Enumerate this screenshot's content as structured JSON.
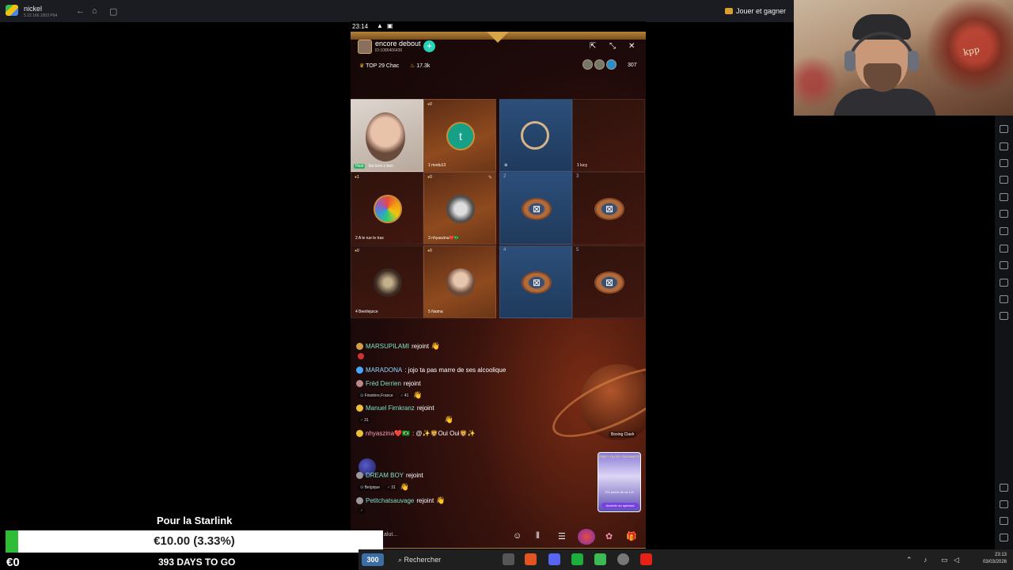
{
  "emulator": {
    "title": "nickel",
    "subtitle": "5.22.166.1003 P64",
    "play_label": "Jouer et gagner",
    "nav": [
      "←",
      "⌂",
      "▢"
    ]
  },
  "webcam": {
    "book_text": "kpp"
  },
  "phone_status": {
    "time": "23:14",
    "warn": "▲",
    "lock": "▣"
  },
  "room": {
    "name": "encore debout",
    "id": "ID:1086406436",
    "follow": "+",
    "top_rank": "TOP 29 Chac",
    "popularity": "17.3k",
    "viewer_count": "307"
  },
  "seats": [
    {
      "num": "",
      "coins": "0",
      "name": "lila hom c bon",
      "badge": "Host"
    },
    {
      "num": "1",
      "coins": "0",
      "name": "modu13",
      "avatar": "t"
    },
    {
      "num": "",
      "coins": "",
      "name": "",
      "avatar": ""
    },
    {
      "num": "1",
      "coins": "",
      "name": "lucy"
    },
    {
      "num": "2",
      "coins": "1",
      "name": "A le rue le trax"
    },
    {
      "num": "3",
      "coins": "0",
      "name": "nhyaszina❤️🇧🇷"
    },
    {
      "num": "2",
      "coins": "",
      "name": ""
    },
    {
      "num": "3",
      "coins": "",
      "name": ""
    },
    {
      "num": "4",
      "coins": "0",
      "name": "Beetlejuice"
    },
    {
      "num": "5",
      "coins": "0",
      "name": "Naima"
    },
    {
      "num": "4",
      "coins": "",
      "name": ""
    },
    {
      "num": "5",
      "coins": "",
      "name": ""
    }
  ],
  "chat": {
    "l1_user": "MARSUPILAMI",
    "l1_msg": "rejoint",
    "l2_user": "MARADONA",
    "l2_msg": ": jojo ta pas marre de ses alcoolique",
    "l3_user": "Fréd Derrien",
    "l3_msg": "rejoint",
    "l3_tag": "Finistère,France",
    "l3_tag2": "41",
    "l4_user": "Manuel Firnkranz",
    "l4_msg": "rejoint",
    "l4_tag": "31",
    "l5_user": "nhyaszina❤️🇧🇷",
    "l5_msg": ": @✨🦁Oui Oui🦁✨",
    "l6_user": "DREAM BOY",
    "l6_msg": "rejoint",
    "l6_tag": "Belgique",
    "l6_tag2": "31",
    "l7_user": "Petitchatsauvage",
    "l7_msg": "rejoint"
  },
  "promo": {
    "tag": "Boxing Clash",
    "title": "FANCY GLORY GAGNANTE",
    "body": "700 points de ca 1v1",
    "button": "Accéder au spectacl"
  },
  "bottom": {
    "say": "alut..."
  },
  "donation": {
    "title": "Pour la Starlink",
    "amount": "€10.00 (3.33%)",
    "start": "€0",
    "days": "393 DAYS TO GO",
    "progress_fraction": 0.0333
  },
  "taskbar": {
    "weather": "300",
    "search": "Rechercher",
    "time": "23:13",
    "date": "03/03/2026"
  },
  "colors": {
    "accent_teal": "#27d3b5",
    "progress_green": "#2ebd34"
  }
}
